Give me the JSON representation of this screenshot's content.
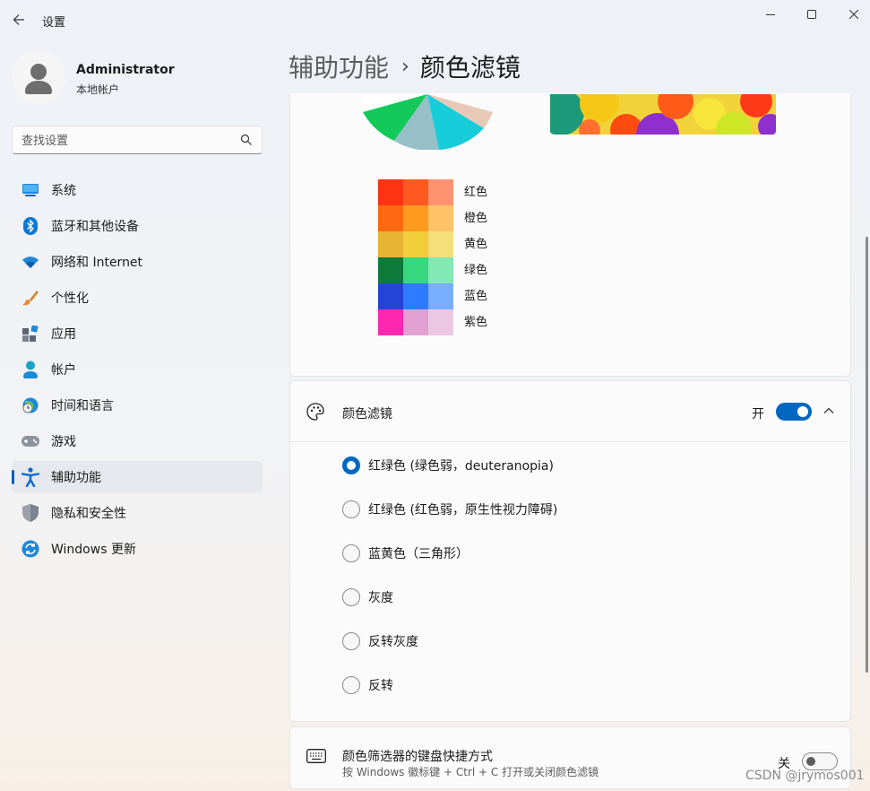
{
  "window": {
    "title": "设置"
  },
  "profile": {
    "name": "Administrator",
    "account_type": "本地帐户"
  },
  "search": {
    "placeholder": "查找设置"
  },
  "nav": [
    {
      "label": "系统",
      "icon": "monitor-icon"
    },
    {
      "label": "蓝牙和其他设备",
      "icon": "bluetooth-icon"
    },
    {
      "label": "网络和 Internet",
      "icon": "wifi-icon"
    },
    {
      "label": "个性化",
      "icon": "brush-icon"
    },
    {
      "label": "应用",
      "icon": "apps-icon"
    },
    {
      "label": "帐户",
      "icon": "person-icon"
    },
    {
      "label": "时间和语言",
      "icon": "globe-clock-icon"
    },
    {
      "label": "游戏",
      "icon": "gamepad-icon"
    },
    {
      "label": "辅助功能",
      "icon": "accessibility-icon",
      "active": true
    },
    {
      "label": "隐私和安全性",
      "icon": "shield-icon"
    },
    {
      "label": "Windows 更新",
      "icon": "update-icon"
    }
  ],
  "breadcrumb": {
    "parent": "辅助功能",
    "separator": "›",
    "current": "颜色滤镜"
  },
  "preview": {
    "swatches": [
      {
        "label": "红色",
        "colors": [
          "#ff3314",
          "#fe5a20",
          "#ff9271"
        ]
      },
      {
        "label": "橙色",
        "colors": [
          "#ff6a10",
          "#ff9a20",
          "#ffc266"
        ]
      },
      {
        "label": "黄色",
        "colors": [
          "#e6b432",
          "#f2cd3a",
          "#f3e07a"
        ]
      },
      {
        "label": "绿色",
        "colors": [
          "#0d7a3a",
          "#37d77e",
          "#82e8b4"
        ]
      },
      {
        "label": "蓝色",
        "colors": [
          "#2444d8",
          "#2e7bff",
          "#7aaeff"
        ]
      },
      {
        "label": "紫色",
        "colors": [
          "#ff28b0",
          "#e2a0d2",
          "#eac8e4"
        ]
      }
    ]
  },
  "color_filter": {
    "title": "颜色滤镜",
    "state_label": "开",
    "enabled": true,
    "options": [
      {
        "label": "红绿色 (绿色弱，deuteranopia)",
        "checked": true
      },
      {
        "label": "红绿色 (红色弱，原生性视力障碍)",
        "checked": false
      },
      {
        "label": "蓝黄色（三角形）",
        "checked": false
      },
      {
        "label": "灰度",
        "checked": false
      },
      {
        "label": "反转灰度",
        "checked": false
      },
      {
        "label": "反转",
        "checked": false
      }
    ]
  },
  "shortcut": {
    "title": "颜色筛选器的键盘快捷方式",
    "description": "按 Windows 徽标键 + Ctrl + C 打开或关闭颜色滤镜",
    "state_label": "关",
    "enabled": false
  },
  "watermark": "CSDN @jrymos001",
  "colors": {
    "accent": "#0067c0"
  }
}
